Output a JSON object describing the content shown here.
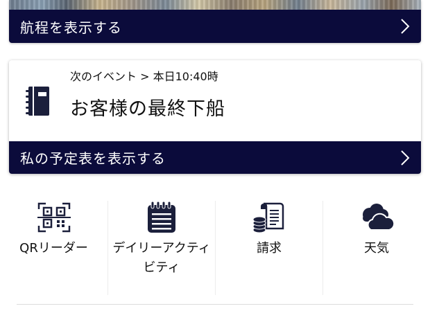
{
  "itinerary": {
    "label": "航程を表示する"
  },
  "event": {
    "meta": "次のイベント > 本日10:40時",
    "title": "お客様の最終下船",
    "schedule_label": "私の予定表を表示する"
  },
  "tiles": [
    {
      "label": "QRリーダー",
      "icon": "qr-code-icon"
    },
    {
      "label": "デイリーアクティビティ",
      "icon": "calendar-icon"
    },
    {
      "label": "請求",
      "icon": "bill-coins-icon"
    },
    {
      "label": "天気",
      "icon": "cloud-icon"
    }
  ],
  "colors": {
    "navy": "#0b0b3b",
    "icon": "#1b1f3b"
  }
}
